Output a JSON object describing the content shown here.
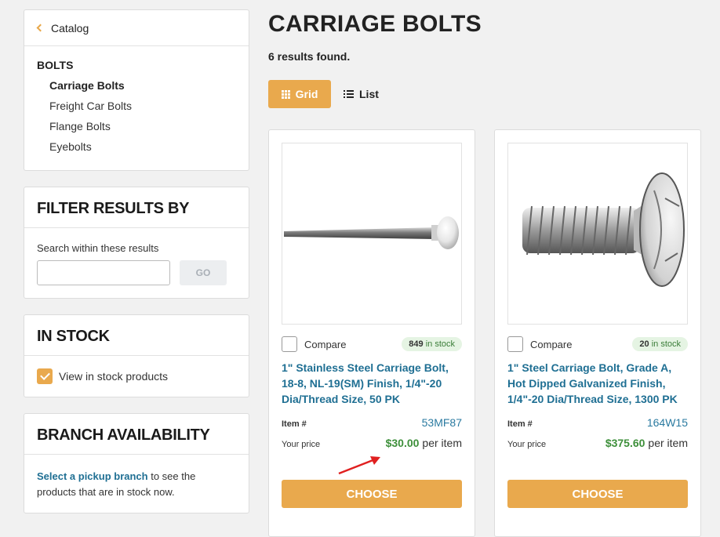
{
  "sidebar": {
    "catalog_link": "Catalog",
    "category_heading": "BOLTS",
    "categories": [
      {
        "label": "Carriage Bolts",
        "active": true
      },
      {
        "label": "Freight Car Bolts",
        "active": false
      },
      {
        "label": "Flange Bolts",
        "active": false
      },
      {
        "label": "Eyebolts",
        "active": false
      }
    ],
    "filter": {
      "title": "FILTER RESULTS BY",
      "search_label": "Search within these results",
      "search_value": "",
      "go_label": "GO"
    },
    "in_stock": {
      "title": "IN STOCK",
      "checkbox_label": "View in stock products",
      "checked": true
    },
    "branch": {
      "title": "BRANCH AVAILABILITY",
      "link_text": "Select a pickup branch",
      "text": " to see the products that are in stock now."
    }
  },
  "main": {
    "title": "CARRIAGE BOLTS",
    "results": "6 results found.",
    "view_grid_label": "Grid",
    "view_list_label": "List",
    "products": [
      {
        "compare_label": "Compare",
        "stock_count": "849",
        "stock_suffix": " in stock",
        "title": "1\" Stainless Steel Carriage Bolt, 18-8, NL-19(SM) Finish, 1/4\"-20 Dia/Thread Size, 50 PK",
        "item_label": "Item #",
        "item_number": "53MF87",
        "price_label": "Your price",
        "price": "$30.00",
        "per_unit": "per item",
        "button": "CHOOSE"
      },
      {
        "compare_label": "Compare",
        "stock_count": "20",
        "stock_suffix": " in stock",
        "title": "1\" Steel Carriage Bolt, Grade A, Hot Dipped Galvanized Finish, 1/4\"-20 Dia/Thread Size, 1300 PK",
        "item_label": "Item #",
        "item_number": "164W15",
        "price_label": "Your price",
        "price": "$375.60",
        "per_unit": "per item",
        "button": "CHOOSE"
      }
    ]
  },
  "colors": {
    "accent": "#e9a94d",
    "link": "#1f6f93",
    "price": "#3d8f3a",
    "annotation_arrow": "#e02020"
  }
}
